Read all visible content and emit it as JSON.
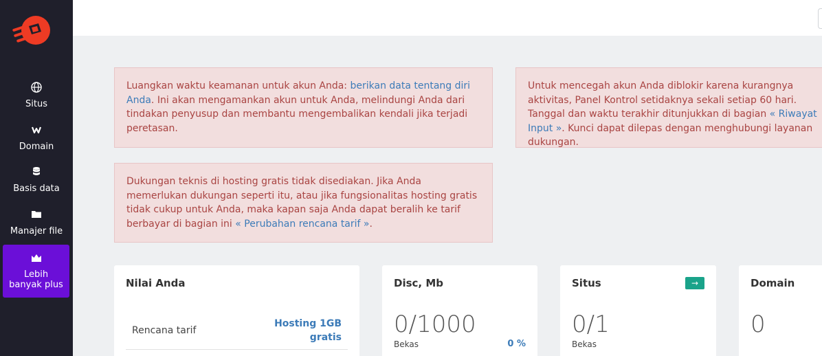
{
  "sidebar": {
    "items": [
      {
        "label": "Situs",
        "icon": "globe-icon"
      },
      {
        "label": "Domain",
        "icon": "w-icon"
      },
      {
        "label": "Basis data",
        "icon": "database-icon"
      },
      {
        "label": "Manajer file",
        "icon": "folder-icon"
      }
    ],
    "plus": {
      "label_line1": "Lebih",
      "label_line2": "banyak plus",
      "icon": "crown-icon"
    }
  },
  "alerts": {
    "security": {
      "text1": "Luangkan waktu keamanan untuk akun Anda: ",
      "link": "berikan data tentang diri Anda",
      "text2": ". Ini akan mengamankan akun untuk Anda, melindungi Anda dari tindakan penyusup dan membantu mengembalikan kendali jika terjadi peretasan."
    },
    "activity": {
      "text1": "Untuk mencegah akun Anda diblokir karena kurangnya aktivitas, Panel Kontrol setidaknya sekali setiap 60 hari. Tanggal dan waktu terakhir ditunjukkan di bagian ",
      "link": "« Riwayat Input »",
      "text2": ". Kunci dapat dilepas dengan menghubungi layanan dukungan."
    },
    "support": {
      "text1": "Dukungan teknis di hosting gratis tidak disediakan. Jika Anda memerlukan dukungan seperti itu, atau jika fungsionalitas hosting gratis tidak cukup untuk Anda, maka kapan saja Anda dapat beralih ke tarif berbayar di bagian ini ",
      "link": "« Perubahan rencana tarif »",
      "text2": "."
    }
  },
  "cards": {
    "plan": {
      "title": "Nilai Anda",
      "row_label": "Rencana tarif",
      "row_value_line1": "Hosting 1GB",
      "row_value_line2": "gratis"
    },
    "disk": {
      "title": "Disc, Mb",
      "value": "0/1000",
      "label": "Bekas",
      "percent": "0 %"
    },
    "sites": {
      "title": "Situs",
      "value": "0/1",
      "label": "Bekas",
      "badge": "→"
    },
    "domains": {
      "title": "Domain",
      "value": "0"
    }
  },
  "colors": {
    "sidebar": "#1f1f2b",
    "plus_button": "#6b0fd8",
    "logo": "#ee3b24",
    "alert_bg": "#f2dede",
    "alert_text": "#a94442",
    "link": "#3c7bb8",
    "badge": "#1aa38a"
  }
}
